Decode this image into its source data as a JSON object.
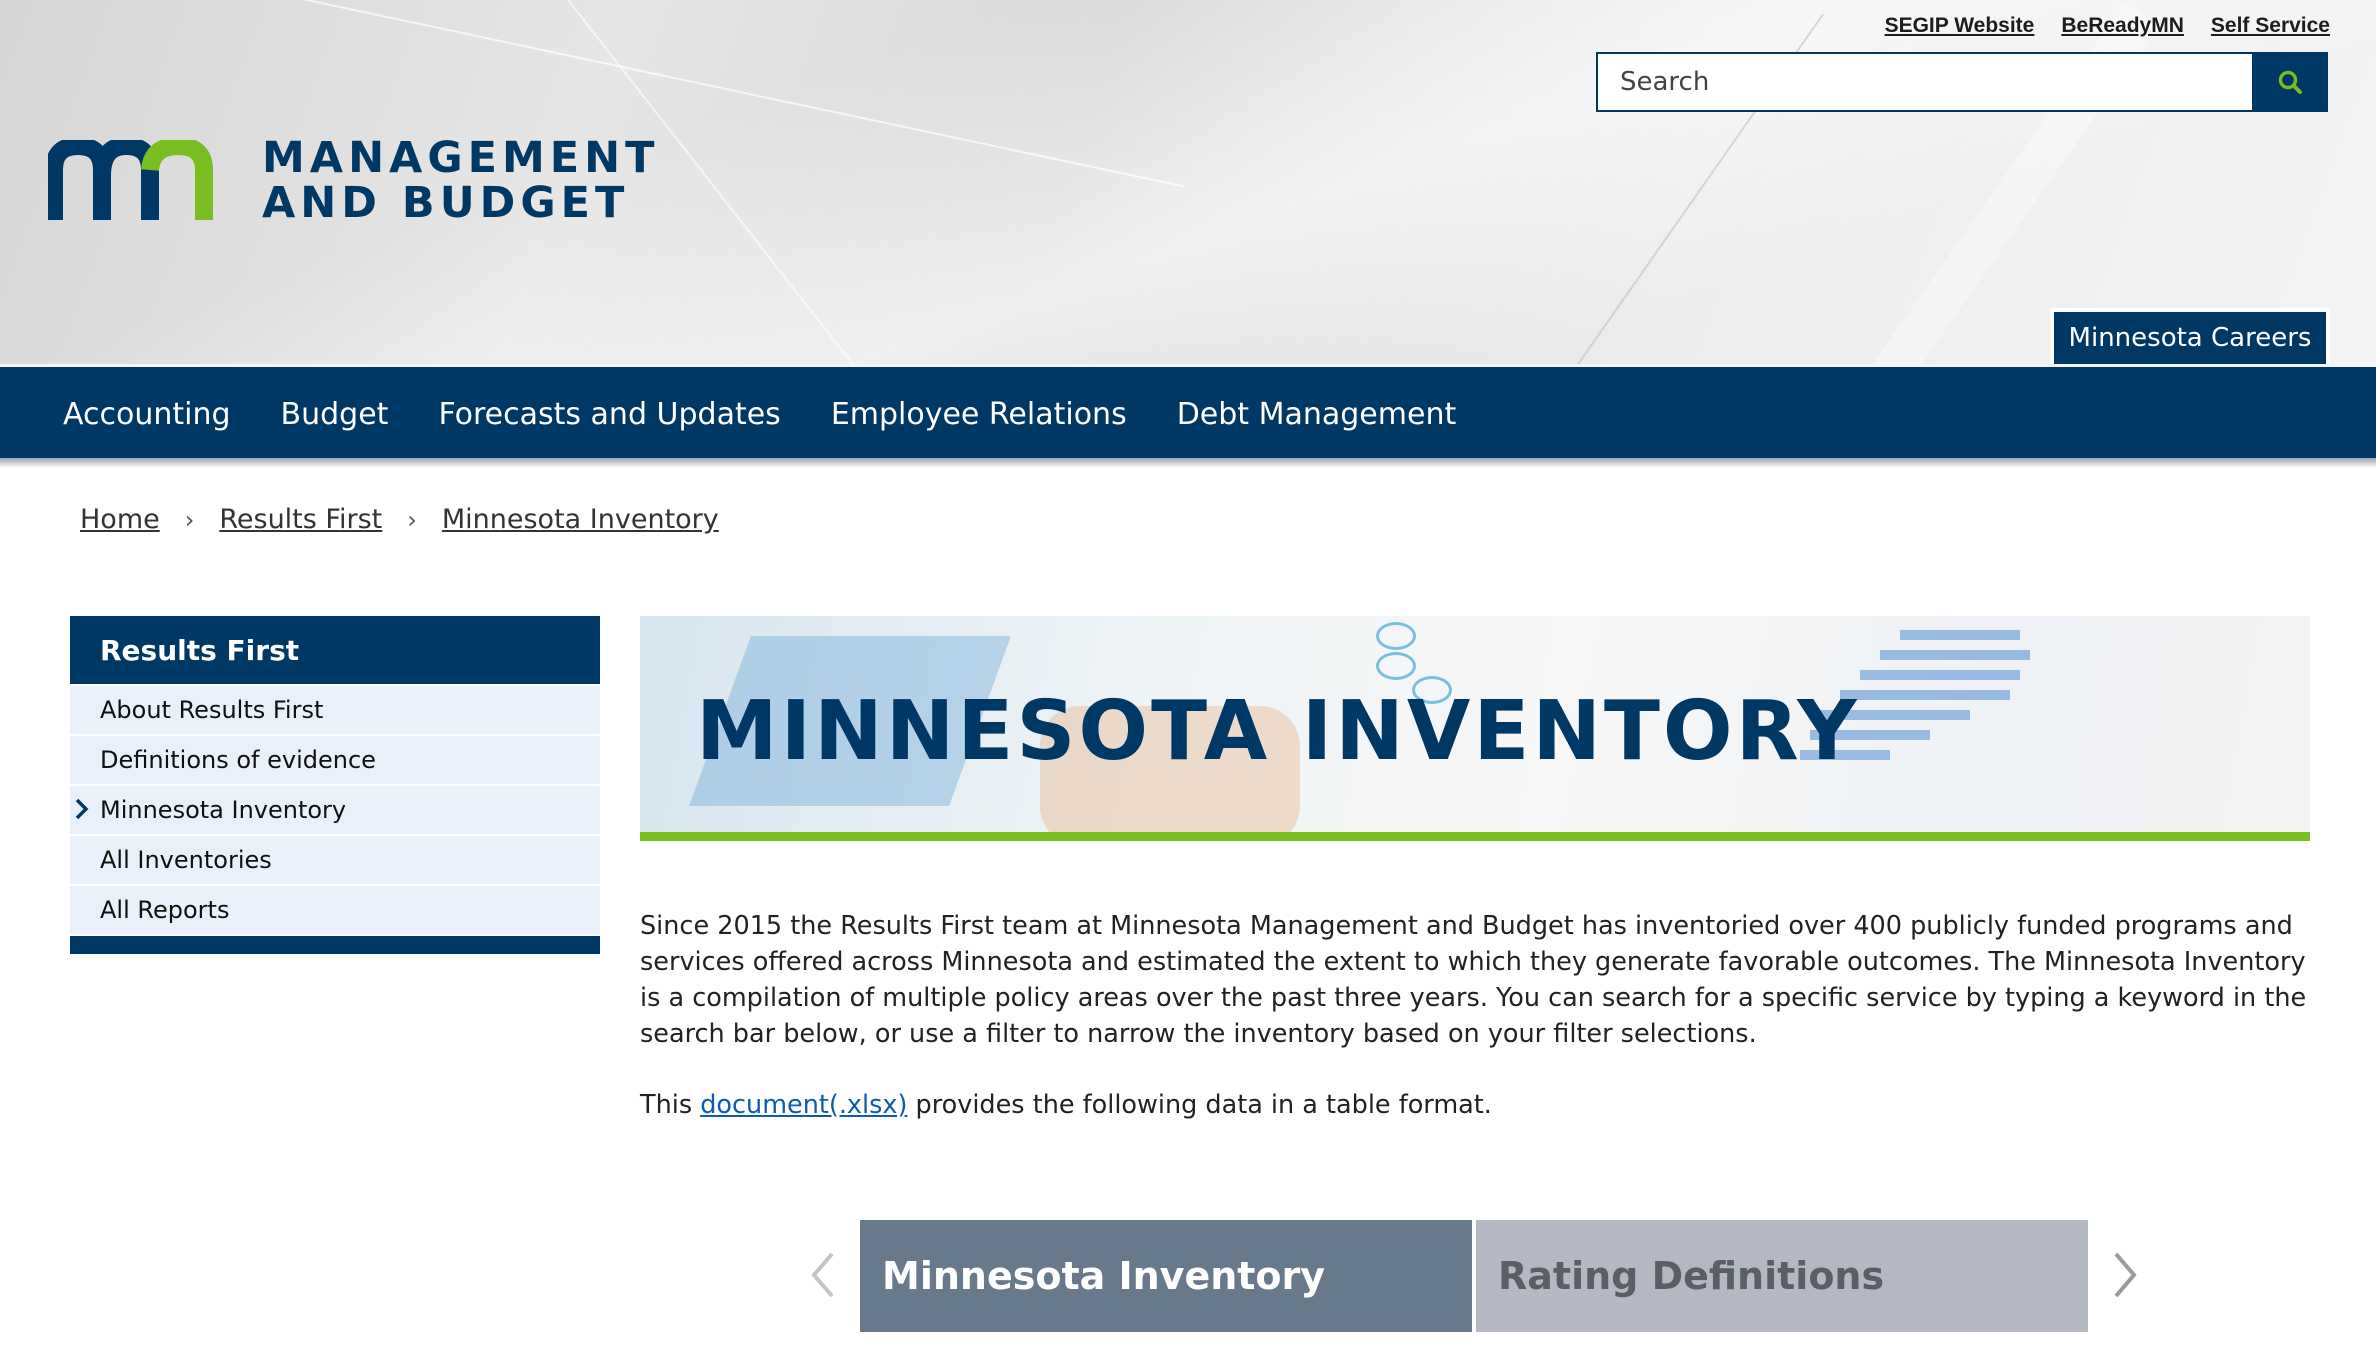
{
  "header": {
    "logo_line1": "MANAGEMENT",
    "logo_line2": "AND BUDGET",
    "utility_links": [
      "SEGIP Website",
      "BeReadyMN",
      "Self Service"
    ],
    "search_placeholder": "Search",
    "careers_tab": "Minnesota Careers"
  },
  "nav": {
    "items": [
      "Accounting",
      "Budget",
      "Forecasts and Updates",
      "Employee Relations",
      "Debt Management"
    ]
  },
  "breadcrumb": [
    "Home",
    "Results First",
    "Minnesota Inventory"
  ],
  "sidebar": {
    "title": "Results First",
    "items": [
      "About Results First",
      "Definitions of evidence",
      "Minnesota Inventory",
      "All Inventories",
      "All Reports"
    ],
    "current_index": 2
  },
  "banner": {
    "title": "MINNESOTA INVENTORY"
  },
  "content": {
    "intro": "Since 2015 the Results First team at Minnesota Management and Budget has inventoried over 400 publicly funded programs and services offered across Minnesota and estimated the extent to which they generate favorable outcomes. The Minnesota Inventory is a compilation of multiple policy areas over the past three years. You can search for a specific service by typing a keyword in the search bar below, or use a filter to narrow the inventory based on your filter selections.",
    "doc_prefix": "This ",
    "doc_link": "document(.xlsx)",
    "doc_suffix": " provides the following data in a table format."
  },
  "tabs": {
    "items": [
      "Minnesota Inventory",
      "Rating Definitions"
    ],
    "active_index": 0
  },
  "colors": {
    "brand_navy": "#003865",
    "brand_green": "#78be20",
    "link_blue": "#0a5db3",
    "sidebar_item_bg": "#e8f0f9"
  },
  "icons": [
    "search-icon",
    "chevron-right-icon",
    "arrow-left-icon",
    "arrow-right-icon",
    "mn-logo-icon"
  ]
}
